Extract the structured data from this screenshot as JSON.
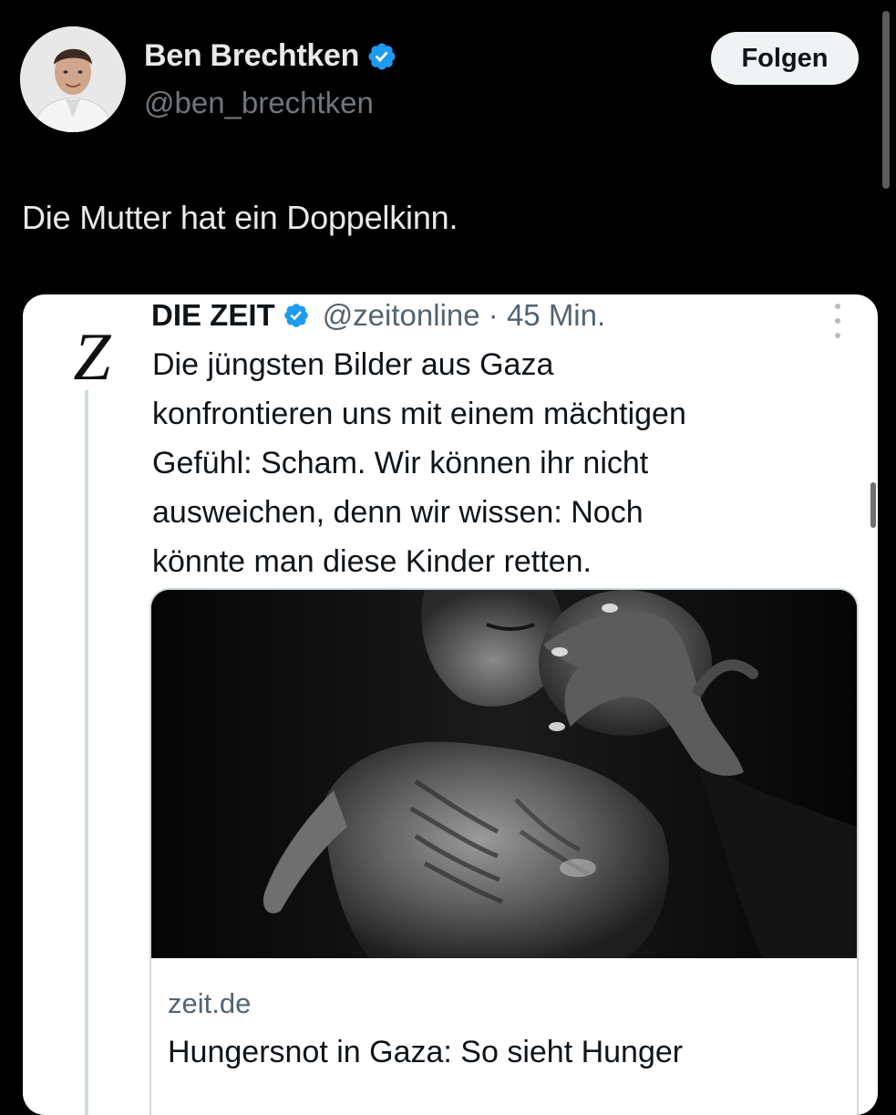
{
  "author": {
    "name": "Ben Brechtken",
    "handle": "@ben_brechtken",
    "verified": true,
    "avatar_icon": "person-avatar"
  },
  "follow_button": {
    "label": "Folgen"
  },
  "tweet": {
    "text": "Die Mutter hat ein Doppelkinn."
  },
  "quoted_tweet": {
    "logo_text": "Z",
    "name": "DIE ZEIT",
    "verified": true,
    "handle_and_time": "@zeitonline · 45 Min.",
    "more_icon": "more-vertical-icon",
    "text_lines": [
      "Die jüngsten Bilder aus Gaza",
      "konfrontieren uns mit einem mächtigen",
      "Gefühl: Scham. Wir können ihr nicht",
      "ausweichen, denn wir wissen: Noch",
      "könnte man diese Kinder retten."
    ],
    "link_card": {
      "domain": "zeit.de",
      "title": "Hungersnot in Gaza: So sieht Hunger"
    }
  },
  "colors": {
    "background": "#000000",
    "verified_blue": "#1d9bf0",
    "secondary_text": "#71767b",
    "card_background": "#ffffff"
  }
}
